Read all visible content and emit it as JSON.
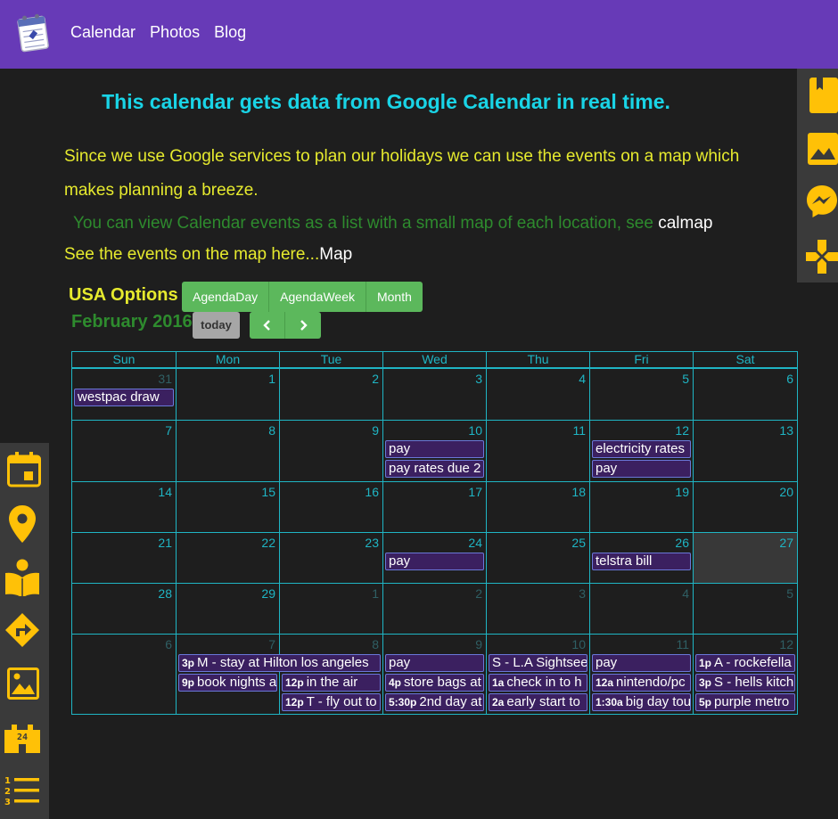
{
  "nav": {
    "items": [
      "Calendar",
      "Photos",
      "Blog"
    ]
  },
  "headline": "This calendar gets data from Google Calendar in real time.",
  "intro": "Since we use Google services to plan our holidays we can use the events on a map which makes planning a breeze.",
  "list_note": {
    "text": "You can view Calendar events as a list with a small map of each location, see",
    "link": "calmap"
  },
  "map_note": {
    "text": "See the events on the map here...",
    "link": "Map"
  },
  "options_title": "USA Options",
  "views": [
    "AgendaDay",
    "AgendaWeek",
    "Month"
  ],
  "month_title": "February 2016",
  "today_label": "today",
  "weekdays": [
    "Sun",
    "Mon",
    "Tue",
    "Wed",
    "Thu",
    "Fri",
    "Sat"
  ],
  "weeks": [
    [
      {
        "d": "31",
        "other": true,
        "events": [
          {
            "title": "westpac draw"
          }
        ]
      },
      {
        "d": "1",
        "events": []
      },
      {
        "d": "2",
        "events": []
      },
      {
        "d": "3",
        "events": []
      },
      {
        "d": "4",
        "events": []
      },
      {
        "d": "5",
        "events": []
      },
      {
        "d": "6",
        "events": []
      }
    ],
    [
      {
        "d": "7",
        "events": []
      },
      {
        "d": "8",
        "events": []
      },
      {
        "d": "9",
        "events": []
      },
      {
        "d": "10",
        "events": [
          {
            "title": "pay"
          },
          {
            "title": "pay rates due 2"
          }
        ]
      },
      {
        "d": "11",
        "events": []
      },
      {
        "d": "12",
        "events": [
          {
            "title": "electricity rates"
          },
          {
            "title": "pay"
          }
        ]
      },
      {
        "d": "13",
        "events": []
      }
    ],
    [
      {
        "d": "14",
        "events": []
      },
      {
        "d": "15",
        "events": []
      },
      {
        "d": "16",
        "events": []
      },
      {
        "d": "17",
        "events": []
      },
      {
        "d": "18",
        "events": []
      },
      {
        "d": "19",
        "events": []
      },
      {
        "d": "20",
        "events": []
      }
    ],
    [
      {
        "d": "21",
        "events": []
      },
      {
        "d": "22",
        "events": []
      },
      {
        "d": "23",
        "events": []
      },
      {
        "d": "24",
        "events": [
          {
            "title": "pay"
          }
        ]
      },
      {
        "d": "25",
        "events": []
      },
      {
        "d": "26",
        "events": [
          {
            "title": "telstra bill"
          }
        ]
      },
      {
        "d": "27",
        "today": true,
        "events": []
      }
    ],
    [
      {
        "d": "28",
        "events": []
      },
      {
        "d": "29",
        "events": []
      },
      {
        "d": "1",
        "other": true,
        "events": []
      },
      {
        "d": "2",
        "other": true,
        "events": []
      },
      {
        "d": "3",
        "other": true,
        "events": []
      },
      {
        "d": "4",
        "other": true,
        "events": []
      },
      {
        "d": "5",
        "other": true,
        "events": []
      }
    ],
    [
      {
        "d": "6",
        "other": true,
        "events": []
      },
      {
        "d": "7",
        "other": true,
        "events": [
          {
            "time": "3p",
            "title": "M - stay at Hilton los angeles",
            "span": 2
          },
          {
            "time": "9p",
            "title": "book nights a"
          }
        ]
      },
      {
        "d": "8",
        "other": true,
        "events": [
          {
            "slot": 1,
            "time": "12p",
            "title": "in the air"
          },
          {
            "time": "12p",
            "title": "T - fly out to"
          }
        ]
      },
      {
        "d": "9",
        "other": true,
        "events": [
          {
            "title": "pay"
          },
          {
            "time": "4p",
            "title": "store bags at"
          },
          {
            "time": "5:30p",
            "title": "2nd day at"
          }
        ]
      },
      {
        "d": "10",
        "other": true,
        "events": [
          {
            "title": "S - L.A Sightseeing"
          },
          {
            "time": "1a",
            "title": "check in to h"
          },
          {
            "time": "2a",
            "title": "early start to"
          }
        ]
      },
      {
        "d": "11",
        "other": true,
        "events": [
          {
            "title": "pay"
          },
          {
            "time": "12a",
            "title": "nintendo/pc"
          },
          {
            "time": "1:30a",
            "title": "big day tour"
          }
        ]
      },
      {
        "d": "12",
        "other": true,
        "events": [
          {
            "time": "1p",
            "title": "A - rockefella"
          },
          {
            "time": "3p",
            "title": "S - hells kitch"
          },
          {
            "time": "5p",
            "title": "purple metro"
          }
        ]
      }
    ]
  ],
  "colors": {
    "topbar": "#673ab7",
    "headline": "#19d4e6",
    "text_yellow": "#e6ea2e",
    "text_green": "#2e8b2e",
    "grid": "#1fb5c4",
    "button_green": "#5cb85c",
    "icon_amber": "#ffc107",
    "event_bg": "#3b2060"
  },
  "right_sidebar_icons": [
    "bookmark-icon",
    "image-icon",
    "messenger-icon",
    "gamepad-icon"
  ],
  "left_sidebar_icons": [
    "calendar-icon",
    "map-pin-icon",
    "reader-icon",
    "directions-icon",
    "photo-icon",
    "open-24-icon",
    "numbered-list-icon"
  ]
}
